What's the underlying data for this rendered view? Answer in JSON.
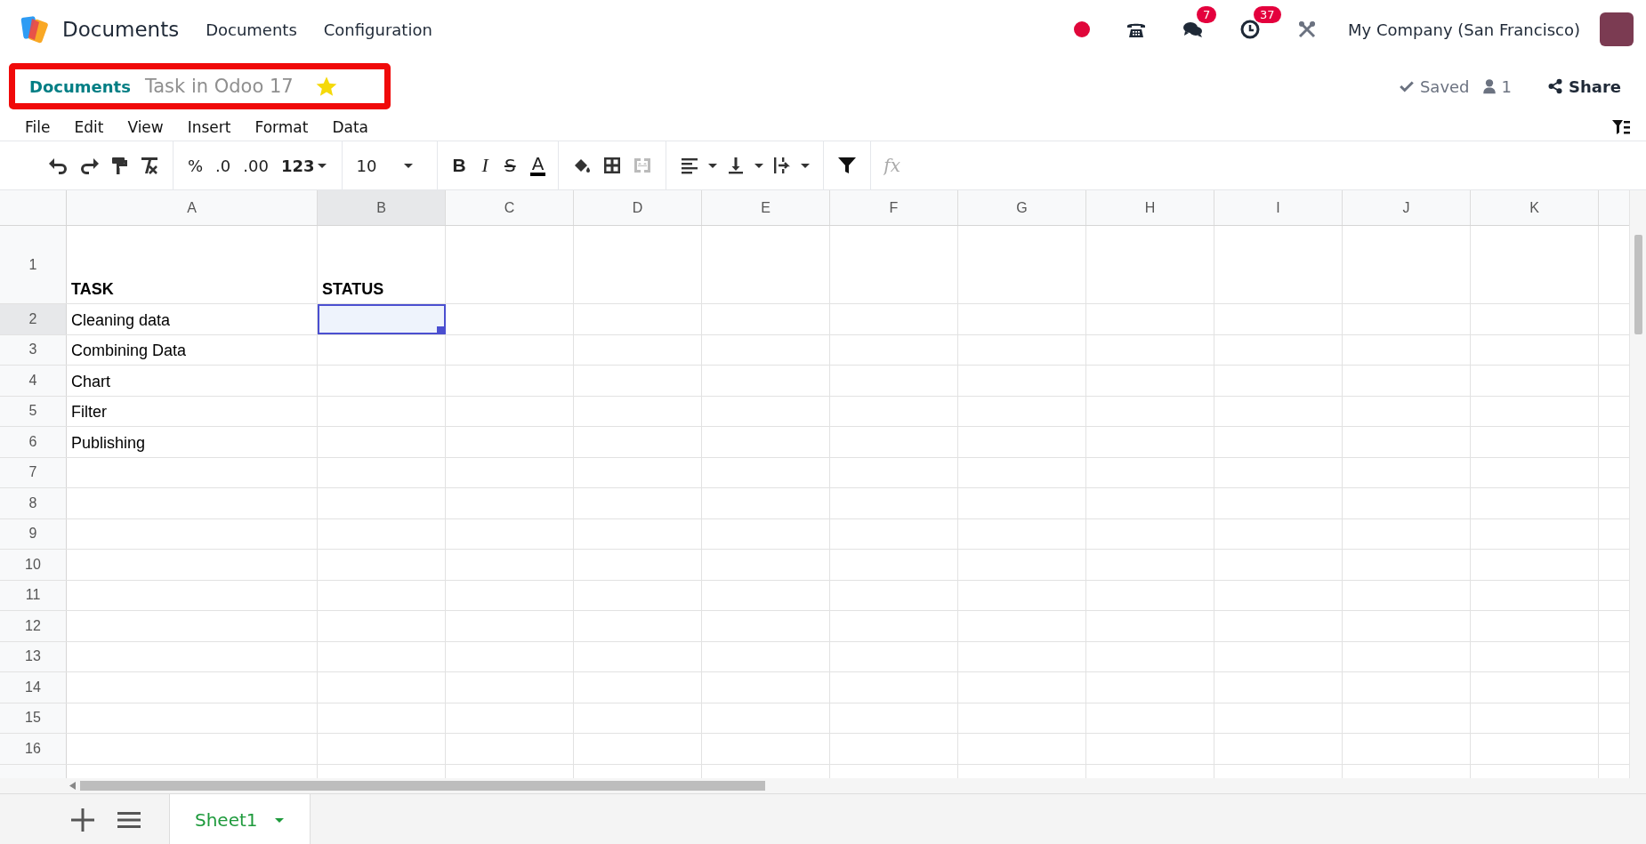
{
  "navbar": {
    "app_name": "Documents",
    "menus": [
      "Documents",
      "Configuration"
    ],
    "messages_badge": "7",
    "activities_badge": "37",
    "company": "My Company (San Francisco)"
  },
  "breadcrumb": {
    "parent": "Documents",
    "title": "Task in Odoo 17",
    "starred": true
  },
  "status": {
    "saved": "Saved",
    "users": "1",
    "share": "Share"
  },
  "menu": [
    "File",
    "Edit",
    "View",
    "Insert",
    "Format",
    "Data"
  ],
  "toolbar": {
    "number_formats": [
      "%",
      ".0",
      ".00",
      "123"
    ],
    "font_size": "10",
    "text_styles": [
      "B",
      "I",
      "S",
      "A"
    ],
    "formula_placeholder": "fx"
  },
  "grid": {
    "columns": [
      {
        "label": "A",
        "selected": false
      },
      {
        "label": "B",
        "selected": true
      },
      {
        "label": "C",
        "selected": false
      },
      {
        "label": "D",
        "selected": false
      },
      {
        "label": "E",
        "selected": false
      },
      {
        "label": "F",
        "selected": false
      },
      {
        "label": "G",
        "selected": false
      },
      {
        "label": "H",
        "selected": false
      },
      {
        "label": "I",
        "selected": false
      },
      {
        "label": "J",
        "selected": false
      },
      {
        "label": "K",
        "selected": false
      }
    ],
    "rows": [
      {
        "label": "1",
        "selected": false,
        "bold": true,
        "cells": [
          "TASK",
          "STATUS"
        ]
      },
      {
        "label": "2",
        "selected": true,
        "bold": false,
        "cells": [
          "Cleaning data"
        ]
      },
      {
        "label": "3",
        "selected": false,
        "bold": false,
        "cells": [
          "Combining Data"
        ]
      },
      {
        "label": "4",
        "selected": false,
        "bold": false,
        "cells": [
          "Chart"
        ]
      },
      {
        "label": "5",
        "selected": false,
        "bold": false,
        "cells": [
          "Filter"
        ]
      },
      {
        "label": "6",
        "selected": false,
        "bold": false,
        "cells": [
          "Publishing"
        ]
      },
      {
        "label": "7",
        "selected": false
      },
      {
        "label": "8",
        "selected": false
      },
      {
        "label": "9",
        "selected": false
      },
      {
        "label": "10",
        "selected": false
      },
      {
        "label": "11",
        "selected": false
      },
      {
        "label": "12",
        "selected": false
      },
      {
        "label": "13",
        "selected": false
      },
      {
        "label": "14",
        "selected": false
      },
      {
        "label": "15",
        "selected": false
      },
      {
        "label": "16",
        "selected": false
      }
    ]
  },
  "sheets": [
    {
      "name": "Sheet1",
      "selected": true
    }
  ]
}
